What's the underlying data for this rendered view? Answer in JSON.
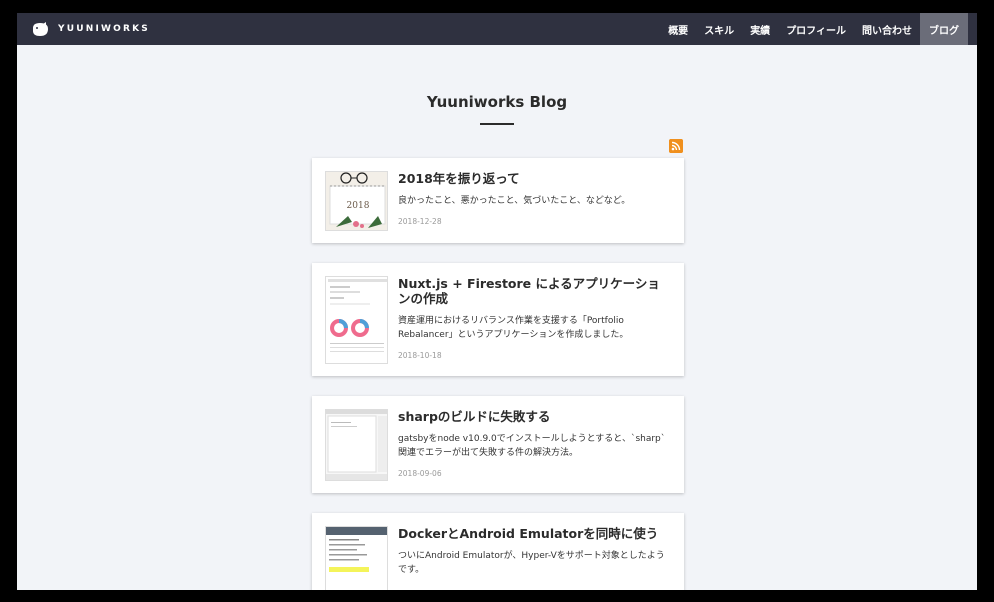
{
  "brand": {
    "name": "YUUNIWORKS"
  },
  "nav": {
    "items": [
      {
        "label": "概要"
      },
      {
        "label": "スキル"
      },
      {
        "label": "実績"
      },
      {
        "label": "プロフィール"
      },
      {
        "label": "問い合わせ"
      },
      {
        "label": "ブログ",
        "active": true
      }
    ]
  },
  "page": {
    "title": "Yuuniworks Blog"
  },
  "rss": {
    "icon": "rss-icon",
    "color": "#f0901e"
  },
  "posts": [
    {
      "title": "2018年を振り返って",
      "description": "良かったこと、悪かったこと、気づいたこと、などなど。",
      "date": "2018-12-28",
      "thumb": "calendar-glasses"
    },
    {
      "title": "Nuxt.js + Firestore によるアプリケーションの作成",
      "description": "資産運用におけるリバランス作業を支援する「Portfolio Rebalancer」というアプリケーションを作成しました。",
      "date": "2018-10-18",
      "thumb": "donut-chart-screenshot"
    },
    {
      "title": "sharpのビルドに失敗する",
      "description": "gatsbyをnode v10.9.0でインストールしようとすると、`sharp`関連でエラーが出て失敗する件の解決方法。",
      "date": "2018-09-06",
      "thumb": "editor-screenshot"
    },
    {
      "title": "DockerとAndroid Emulatorを同時に使う",
      "description": "ついにAndroid Emulatorが、Hyper-Vをサポート対象としたようです。",
      "date": "",
      "thumb": "settings-screenshot"
    }
  ],
  "colors": {
    "navbar": "#2f3140",
    "nav_active": "#6b6d79",
    "background": "#f2f4f8"
  }
}
